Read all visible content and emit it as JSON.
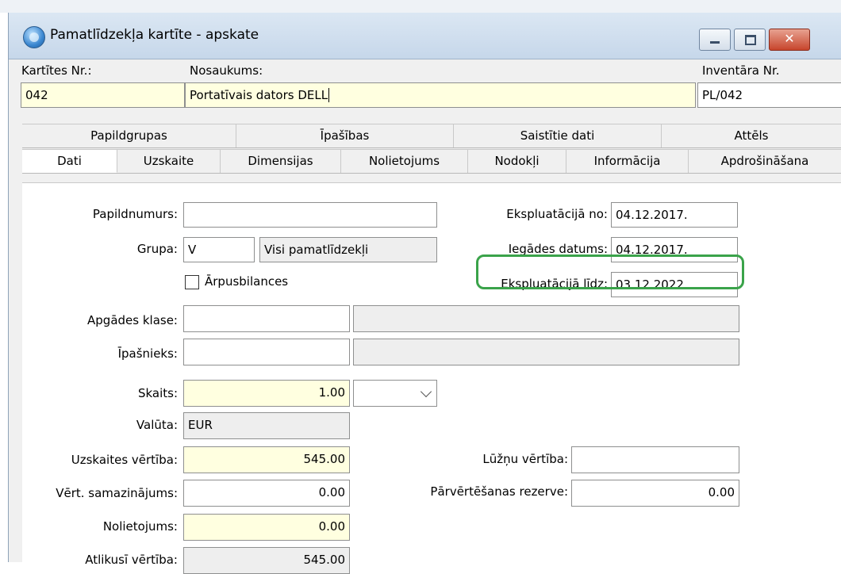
{
  "window": {
    "title": "Pamatlīdzekļa kartīte - apskate",
    "close_glyph": "✕"
  },
  "header": {
    "card_no_label": "Kartītes Nr.:",
    "card_no_value": "042",
    "name_label": "Nosaukums:",
    "name_value": "Portatīvais dators DELL",
    "inventory_label": "Inventāra Nr.",
    "inventory_value": "PL/042"
  },
  "tabs_row1": [
    "Papildgrupas",
    "Īpašības",
    "Saistītie dati",
    "Attēls"
  ],
  "tabs_row2": [
    "Dati",
    "Uzskaite",
    "Dimensijas",
    "Nolietojums",
    "Nodokļi",
    "Informācija",
    "Apdrošināšana"
  ],
  "active_tab": "Dati",
  "form": {
    "papildnumurs": {
      "label": "Papildnumurs:",
      "value": ""
    },
    "grupa": {
      "label": "Grupa:",
      "code": "V",
      "name": "Visi pamatlīdzekļi"
    },
    "arpusbilances": {
      "label": "Ārpusbilances",
      "checked": false
    },
    "apgades_klase": {
      "label": "Apgādes klase:",
      "value": "",
      "desc": ""
    },
    "ipasnieks": {
      "label": "Īpašnieks:",
      "value": "",
      "desc": ""
    },
    "skaits": {
      "label": "Skaits:",
      "value": "1.00",
      "unit": ""
    },
    "valuta": {
      "label": "Valūta:",
      "value": "EUR"
    },
    "uzskaites_vertiba": {
      "label": "Uzskaites vērtība:",
      "value": "545.00"
    },
    "vert_samazinajums": {
      "label": "Vērt. samazinājums:",
      "value": "0.00"
    },
    "nolietojums": {
      "label": "Nolietojums:",
      "value": "0.00"
    },
    "atlikusi_vertiba": {
      "label": "Atlikusī vērtība:",
      "value": "545.00"
    },
    "ekspl_no": {
      "label": "Ekspluatācijā no:",
      "value": "04.12.2017."
    },
    "iegades_datums": {
      "label": "Iegādes datums:",
      "value": "04.12.2017."
    },
    "ekspl_lidz": {
      "label": "Ekspluatācijā līdz:",
      "value": "03.12.2022."
    },
    "luznu_vertiba": {
      "label": "Lūžņu vērtība:",
      "value": ""
    },
    "parvertesanas_rezerve": {
      "label": "Pārvērtēšanas rezerve:",
      "value": "0.00"
    }
  },
  "colors": {
    "highlight": "#3aa34a",
    "required_field": "#ffffe0"
  }
}
